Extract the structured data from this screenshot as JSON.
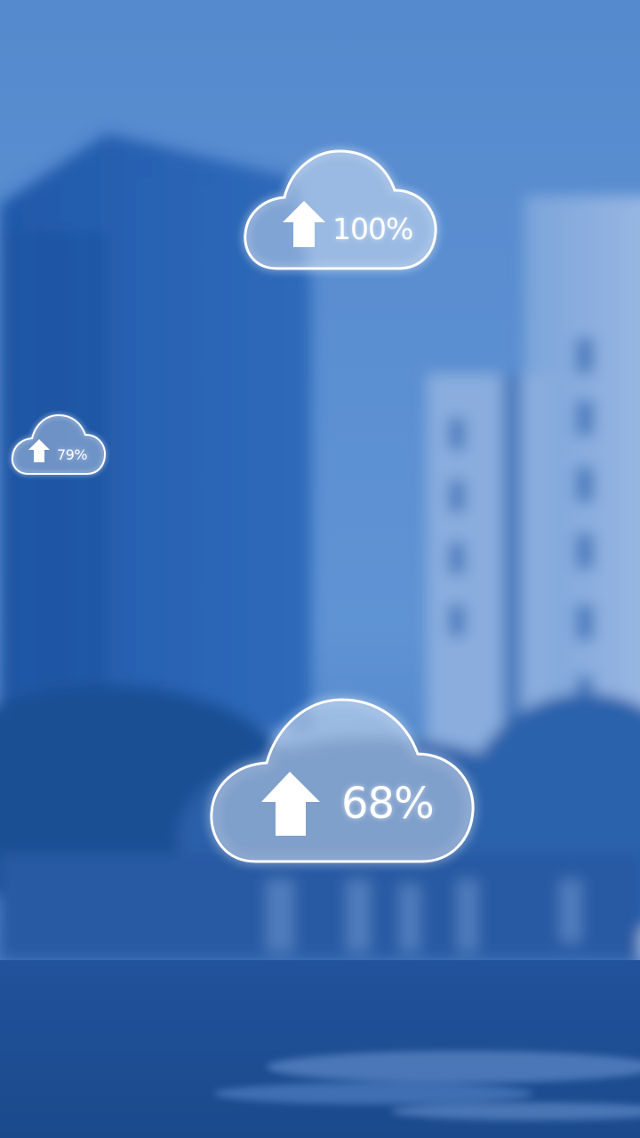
{
  "scene": {
    "sky_color": "#6a9bd6",
    "tint_color": "#2a62b8",
    "water_color": "#1b4a8e"
  },
  "upload_clouds": [
    {
      "id": "cloud-top",
      "icon": "upload-arrow-icon",
      "progress_label": "100%",
      "progress": 1.0
    },
    {
      "id": "cloud-left",
      "icon": "upload-arrow-icon",
      "progress_label": "79%",
      "progress": 0.79
    },
    {
      "id": "cloud-bottom",
      "icon": "upload-arrow-icon",
      "progress_label": "68%",
      "progress": 0.68
    }
  ]
}
